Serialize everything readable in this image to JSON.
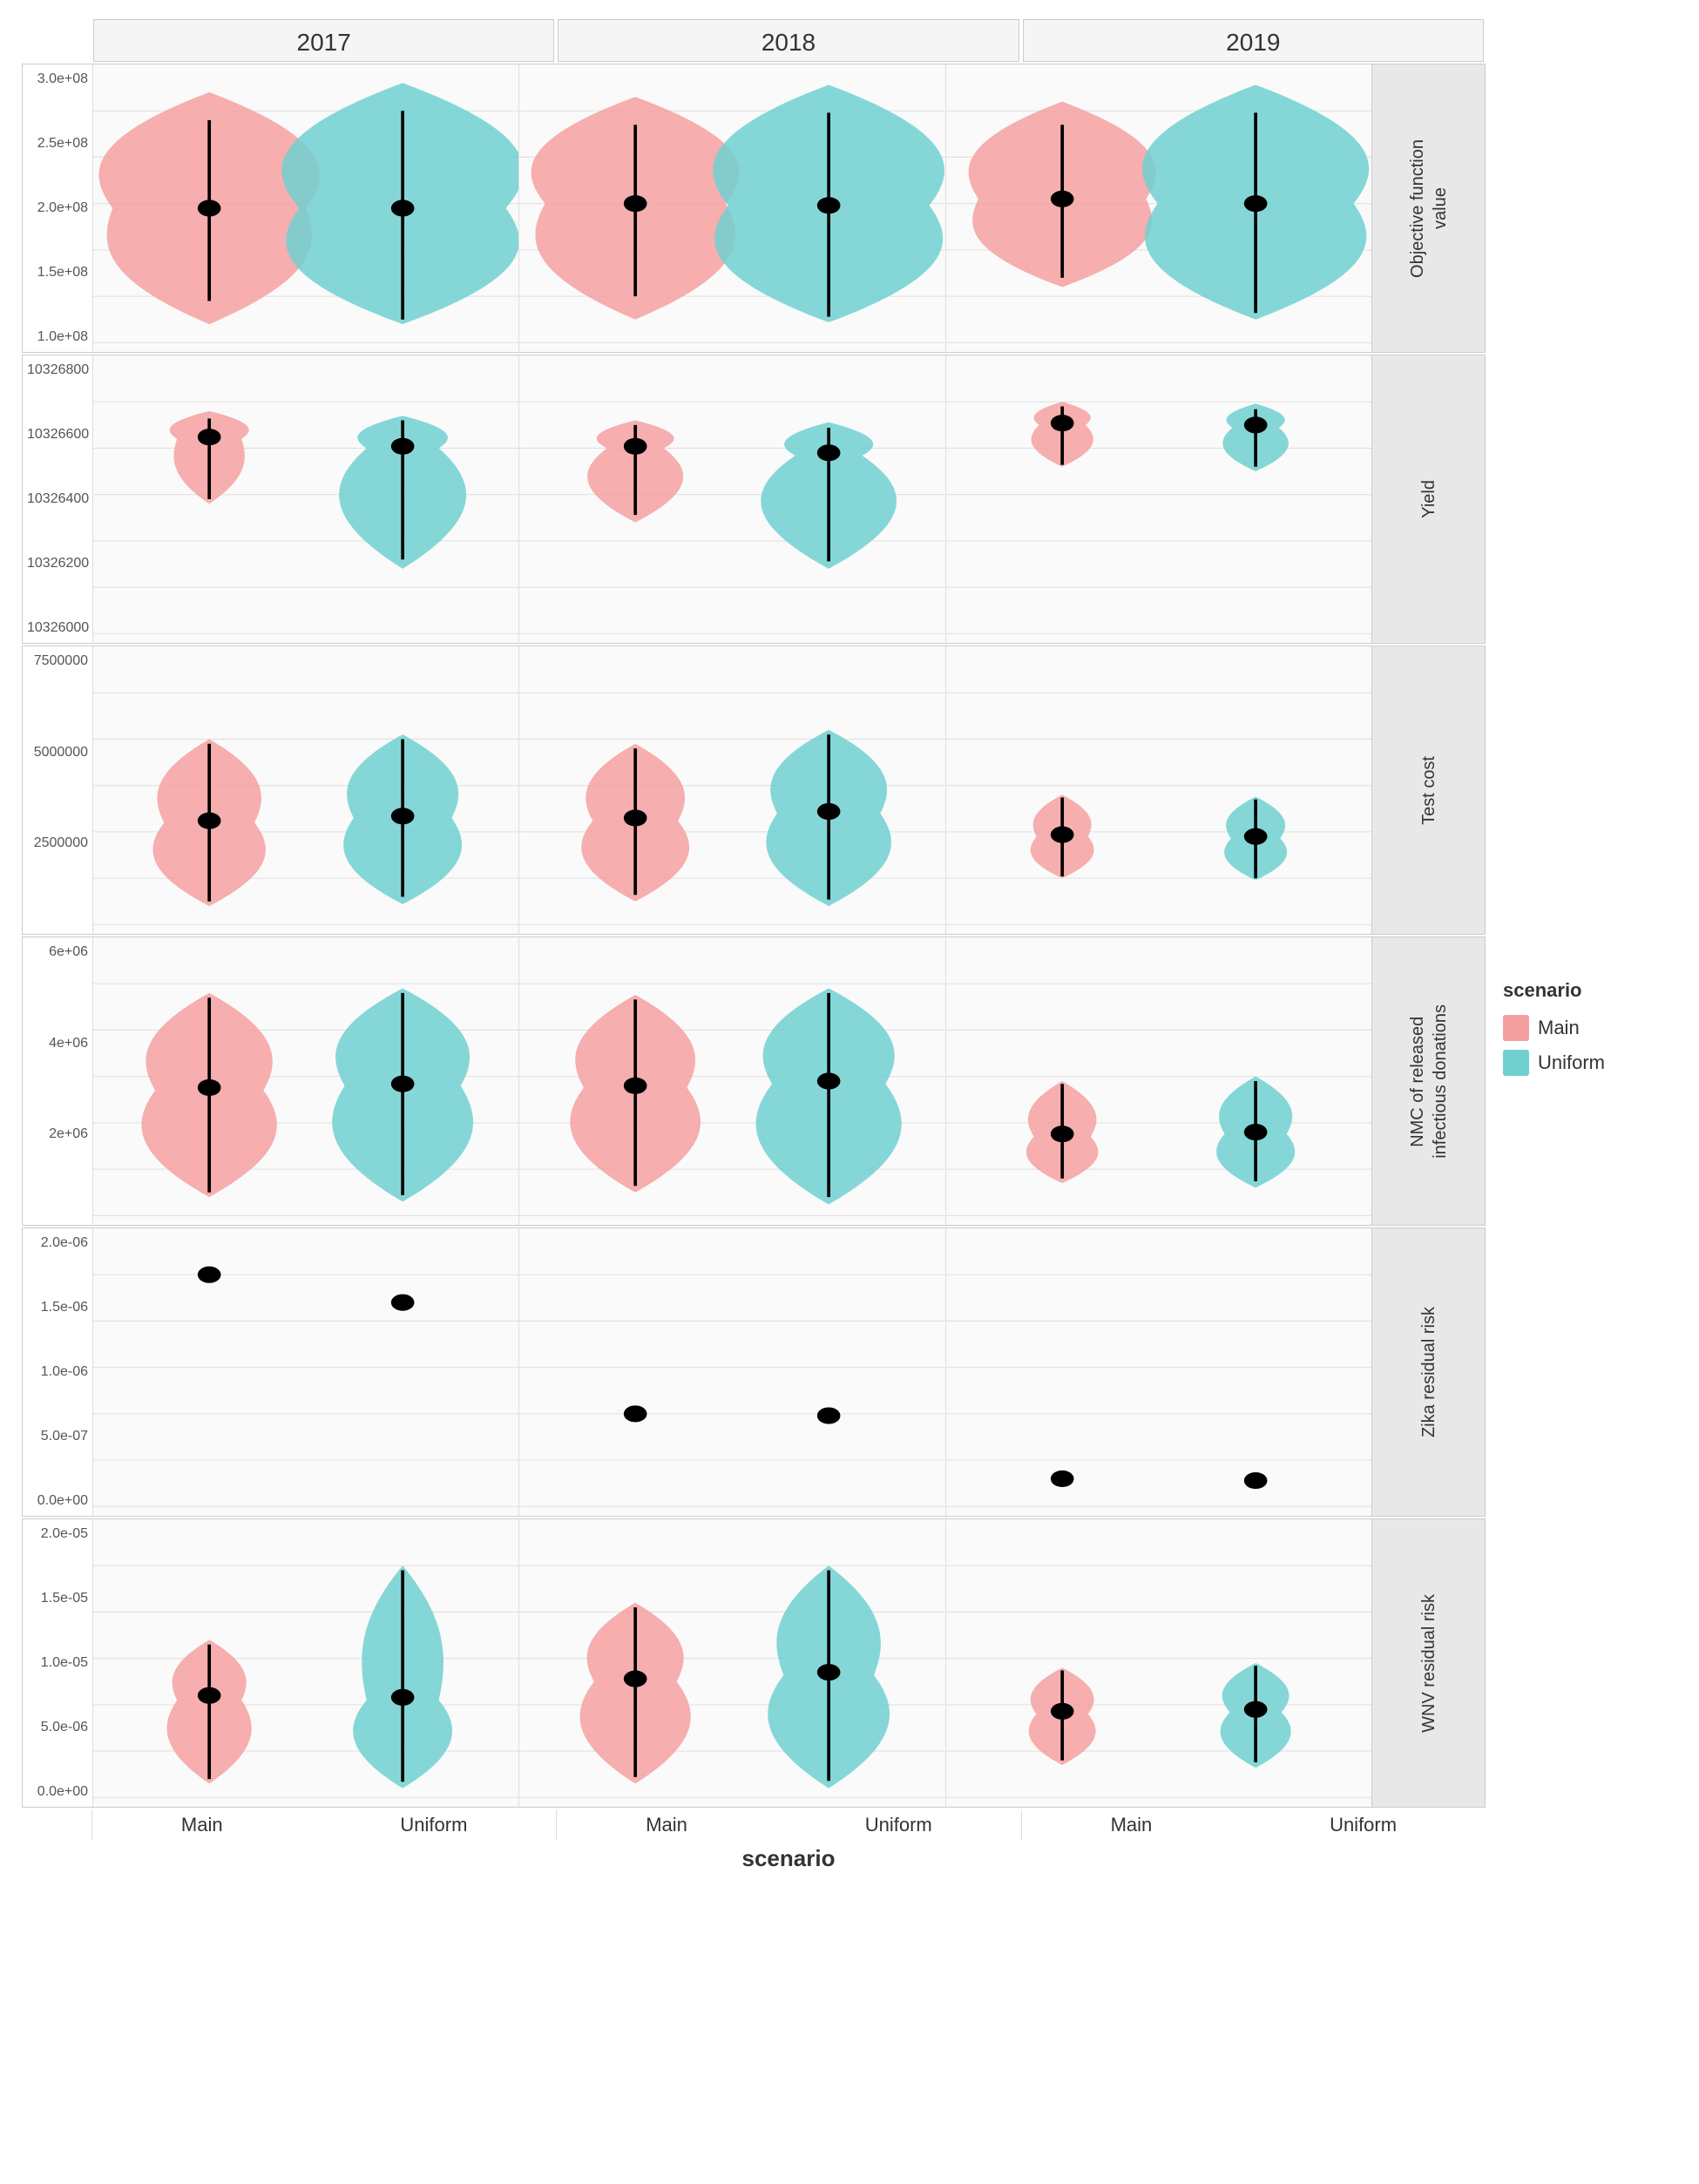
{
  "years": [
    "2017",
    "2018",
    "2019"
  ],
  "x_labels_per_cell": [
    "Main",
    "Uniform"
  ],
  "x_axis_title": "scenario",
  "legend": {
    "title": "scenario",
    "items": [
      {
        "label": "Main",
        "color": "#f4a0a0"
      },
      {
        "label": "Uniform",
        "color": "#70d0d0"
      }
    ]
  },
  "rows": [
    {
      "label": "Objective function\nvalue",
      "y_ticks": [
        "3.0e+08",
        "2.5e+08",
        "2.0e+08",
        "1.5e+08",
        "1.0e+08"
      ],
      "cells": [
        {
          "main_violin": {
            "cx": 90,
            "top": 30,
            "bottom": 280,
            "waist_y": 155,
            "waist_half": 10,
            "top_half": 95,
            "bottom_half": 85,
            "mid_half": 75
          },
          "uniform_violin": {
            "cx": 240,
            "top": 20,
            "bottom": 280,
            "waist_y": 155,
            "waist_half": 15,
            "top_half": 105,
            "bottom_half": 100,
            "mid_half": 80
          },
          "main_dot": {
            "cx": 90,
            "cy": 155
          },
          "main_whisker": {
            "cx": 90,
            "y1": 60,
            "y2": 255
          },
          "uniform_dot": {
            "cx": 240,
            "cy": 155
          },
          "uniform_whisker": {
            "cx": 240,
            "y1": 50,
            "y2": 275
          }
        },
        {
          "main_violin": {
            "cx": 90,
            "top": 35,
            "bottom": 275,
            "waist_y": 150,
            "waist_half": 8,
            "top_half": 90,
            "bottom_half": 85,
            "mid_half": 70
          },
          "uniform_violin": {
            "cx": 240,
            "top": 22,
            "bottom": 278,
            "waist_y": 152,
            "waist_half": 14,
            "top_half": 100,
            "bottom_half": 98,
            "mid_half": 78
          },
          "main_dot": {
            "cx": 90,
            "cy": 150
          },
          "main_whisker": {
            "cx": 90,
            "y1": 65,
            "y2": 250
          },
          "uniform_dot": {
            "cx": 240,
            "cy": 152
          },
          "uniform_whisker": {
            "cx": 240,
            "y1": 52,
            "y2": 272
          }
        },
        {
          "main_violin": {
            "cx": 90,
            "top": 40,
            "bottom": 240,
            "waist_y": 145,
            "waist_half": 7,
            "top_half": 80,
            "bottom_half": 75,
            "mid_half": 65
          },
          "uniform_violin": {
            "cx": 240,
            "top": 22,
            "bottom": 275,
            "waist_y": 150,
            "waist_half": 13,
            "top_half": 98,
            "bottom_half": 95,
            "mid_half": 76
          },
          "main_dot": {
            "cx": 90,
            "cy": 145
          },
          "main_whisker": {
            "cx": 90,
            "y1": 65,
            "y2": 230
          },
          "uniform_dot": {
            "cx": 240,
            "cy": 150
          },
          "uniform_whisker": {
            "cx": 240,
            "y1": 52,
            "y2": 268
          }
        }
      ]
    },
    {
      "label": "Yield",
      "y_ticks": [
        "10326800",
        "10326600",
        "10326400",
        "10326200",
        "10326000"
      ],
      "cells": [
        {
          "main_violin": {
            "cx": 90,
            "top": 60,
            "bottom": 160,
            "waist_y": 90,
            "waist_half": 4,
            "top_half": 35,
            "bottom_half": 30,
            "mid_half": 25
          },
          "uniform_violin": {
            "cx": 240,
            "top": 65,
            "bottom": 230,
            "waist_y": 100,
            "waist_half": 5,
            "top_half": 40,
            "bottom_half": 60,
            "mid_half": 28
          },
          "main_dot": {
            "cx": 90,
            "cy": 88
          },
          "main_whisker": {
            "cx": 90,
            "y1": 68,
            "y2": 155
          },
          "uniform_dot": {
            "cx": 240,
            "cy": 98
          },
          "uniform_whisker": {
            "cx": 240,
            "y1": 70,
            "y2": 220
          }
        },
        {
          "main_violin": {
            "cx": 90,
            "top": 70,
            "bottom": 180,
            "waist_y": 100,
            "waist_half": 4,
            "top_half": 35,
            "bottom_half": 45,
            "mid_half": 22
          },
          "uniform_violin": {
            "cx": 240,
            "top": 72,
            "bottom": 230,
            "waist_y": 108,
            "waist_half": 5,
            "top_half": 40,
            "bottom_half": 65,
            "mid_half": 26
          },
          "main_dot": {
            "cx": 90,
            "cy": 98
          },
          "main_whisker": {
            "cx": 90,
            "y1": 75,
            "y2": 172
          },
          "uniform_dot": {
            "cx": 240,
            "cy": 105
          },
          "uniform_whisker": {
            "cx": 240,
            "y1": 78,
            "y2": 222
          }
        },
        {
          "main_violin": {
            "cx": 90,
            "top": 50,
            "bottom": 120,
            "waist_y": 75,
            "waist_half": 3,
            "top_half": 25,
            "bottom_half": 28,
            "mid_half": 18
          },
          "uniform_violin": {
            "cx": 240,
            "top": 52,
            "bottom": 125,
            "waist_y": 78,
            "waist_half": 3,
            "top_half": 26,
            "bottom_half": 30,
            "mid_half": 18
          },
          "main_dot": {
            "cx": 90,
            "cy": 73
          },
          "main_whisker": {
            "cx": 90,
            "y1": 55,
            "y2": 118
          },
          "uniform_dot": {
            "cx": 240,
            "cy": 75
          },
          "uniform_whisker": {
            "cx": 240,
            "y1": 58,
            "y2": 120
          }
        }
      ]
    },
    {
      "label": "Test cost",
      "y_ticks": [
        "7500000",
        "5000000",
        "2500000",
        ""
      ],
      "cells": [
        {
          "main_violin": {
            "cx": 90,
            "top": 100,
            "bottom": 280,
            "waist_y": 190,
            "waist_half": 5,
            "top_half": 45,
            "bottom_half": 50,
            "mid_half": 35
          },
          "uniform_violin": {
            "cx": 240,
            "top": 95,
            "bottom": 278,
            "waist_y": 185,
            "waist_half": 6,
            "top_half": 48,
            "bottom_half": 52,
            "mid_half": 38
          },
          "main_dot": {
            "cx": 90,
            "cy": 188
          },
          "main_whisker": {
            "cx": 90,
            "y1": 105,
            "y2": 275
          },
          "uniform_dot": {
            "cx": 240,
            "cy": 183
          },
          "uniform_whisker": {
            "cx": 240,
            "y1": 100,
            "y2": 270
          }
        },
        {
          "main_violin": {
            "cx": 90,
            "top": 105,
            "bottom": 275,
            "waist_y": 188,
            "waist_half": 5,
            "top_half": 43,
            "bottom_half": 48,
            "mid_half": 33
          },
          "uniform_violin": {
            "cx": 240,
            "top": 90,
            "bottom": 280,
            "waist_y": 180,
            "waist_half": 7,
            "top_half": 50,
            "bottom_half": 55,
            "mid_half": 40
          },
          "main_dot": {
            "cx": 90,
            "cy": 185
          },
          "main_whisker": {
            "cx": 90,
            "y1": 110,
            "y2": 268
          },
          "uniform_dot": {
            "cx": 240,
            "cy": 178
          },
          "uniform_whisker": {
            "cx": 240,
            "y1": 95,
            "y2": 273
          }
        },
        {
          "main_violin": {
            "cx": 90,
            "top": 160,
            "bottom": 250,
            "waist_y": 205,
            "waist_half": 4,
            "top_half": 25,
            "bottom_half": 28,
            "mid_half": 20
          },
          "uniform_violin": {
            "cx": 240,
            "top": 162,
            "bottom": 252,
            "waist_y": 207,
            "waist_half": 4,
            "top_half": 26,
            "bottom_half": 28,
            "mid_half": 19
          },
          "main_dot": {
            "cx": 90,
            "cy": 203
          },
          "main_whisker": {
            "cx": 90,
            "y1": 163,
            "y2": 248
          },
          "uniform_dot": {
            "cx": 240,
            "cy": 205
          },
          "uniform_whisker": {
            "cx": 240,
            "y1": 165,
            "y2": 250
          }
        }
      ]
    },
    {
      "label": "NMC of released\ninfectious donations",
      "y_ticks": [
        "6e+06",
        "4e+06",
        "2e+06",
        ""
      ],
      "cells": [
        {
          "main_violin": {
            "cx": 90,
            "top": 60,
            "bottom": 280,
            "waist_y": 165,
            "waist_half": 6,
            "top_half": 55,
            "bottom_half": 60,
            "mid_half": 42
          },
          "uniform_violin": {
            "cx": 240,
            "top": 55,
            "bottom": 285,
            "waist_y": 160,
            "waist_half": 7,
            "top_half": 58,
            "bottom_half": 62,
            "mid_half": 45
          },
          "main_dot": {
            "cx": 90,
            "cy": 162
          },
          "main_whisker": {
            "cx": 90,
            "y1": 65,
            "y2": 275
          },
          "uniform_dot": {
            "cx": 240,
            "cy": 158
          },
          "uniform_whisker": {
            "cx": 240,
            "y1": 60,
            "y2": 278
          }
        },
        {
          "main_violin": {
            "cx": 90,
            "top": 62,
            "bottom": 275,
            "waist_y": 162,
            "waist_half": 6,
            "top_half": 52,
            "bottom_half": 58,
            "mid_half": 40
          },
          "uniform_violin": {
            "cx": 240,
            "top": 55,
            "bottom": 288,
            "waist_y": 158,
            "waist_half": 7,
            "top_half": 57,
            "bottom_half": 65,
            "mid_half": 44
          },
          "main_dot": {
            "cx": 90,
            "cy": 160
          },
          "main_whisker": {
            "cx": 90,
            "y1": 67,
            "y2": 268
          },
          "uniform_dot": {
            "cx": 240,
            "cy": 155
          },
          "uniform_whisker": {
            "cx": 240,
            "y1": 60,
            "y2": 280
          }
        },
        {
          "main_violin": {
            "cx": 90,
            "top": 155,
            "bottom": 265,
            "waist_y": 215,
            "waist_half": 5,
            "top_half": 30,
            "bottom_half": 32,
            "mid_half": 22
          },
          "uniform_violin": {
            "cx": 240,
            "top": 150,
            "bottom": 270,
            "waist_y": 212,
            "waist_half": 5,
            "top_half": 32,
            "bottom_half": 35,
            "mid_half": 24
          },
          "main_dot": {
            "cx": 90,
            "cy": 212
          },
          "main_whisker": {
            "cx": 90,
            "y1": 158,
            "y2": 260
          },
          "uniform_dot": {
            "cx": 240,
            "cy": 210
          },
          "uniform_whisker": {
            "cx": 240,
            "y1": 155,
            "y2": 263
          }
        }
      ]
    },
    {
      "label": "Zika residual risk",
      "y_ticks": [
        "2.0e-06",
        "1.5e-06",
        "1.0e-06",
        "5.0e-07",
        "0.0e+00"
      ],
      "cells": [
        {
          "main_violin": null,
          "uniform_violin": null,
          "main_dot": {
            "cx": 90,
            "cy": 50
          },
          "main_whisker": null,
          "uniform_dot": {
            "cx": 240,
            "cy": 80
          },
          "uniform_whisker": null
        },
        {
          "main_violin": null,
          "uniform_violin": null,
          "main_dot": {
            "cx": 90,
            "cy": 200
          },
          "main_whisker": null,
          "uniform_dot": {
            "cx": 240,
            "cy": 202
          },
          "uniform_whisker": null
        },
        {
          "main_violin": null,
          "uniform_violin": null,
          "main_dot": {
            "cx": 90,
            "cy": 270
          },
          "main_whisker": null,
          "uniform_dot": {
            "cx": 240,
            "cy": 272
          },
          "uniform_whisker": null
        }
      ]
    },
    {
      "label": "WNV residual risk",
      "y_ticks": [
        "2.0e-05",
        "1.5e-05",
        "1.0e-05",
        "5.0e-06",
        "0.0e+00"
      ],
      "cells": [
        {
          "main_violin": {
            "cx": 90,
            "top": 130,
            "bottom": 285,
            "waist_y": 195,
            "waist_half": 4,
            "top_half": 32,
            "bottom_half": 38,
            "mid_half": 25
          },
          "uniform_violin": {
            "cx": 240,
            "top": 50,
            "bottom": 290,
            "waist_y": 195,
            "waist_half": 4,
            "top_half": 35,
            "bottom_half": 45,
            "mid_half": 28
          },
          "main_dot": {
            "cx": 90,
            "cy": 190
          },
          "main_whisker": {
            "cx": 90,
            "y1": 135,
            "y2": 280
          },
          "uniform_dot": {
            "cx": 240,
            "cy": 192
          },
          "uniform_whisker": {
            "cx": 240,
            "y1": 55,
            "y2": 283
          }
        },
        {
          "main_violin": {
            "cx": 90,
            "top": 90,
            "bottom": 285,
            "waist_y": 175,
            "waist_half": 5,
            "top_half": 42,
            "bottom_half": 50,
            "mid_half": 32
          },
          "uniform_violin": {
            "cx": 240,
            "top": 50,
            "bottom": 290,
            "waist_y": 168,
            "waist_half": 5,
            "top_half": 45,
            "bottom_half": 55,
            "mid_half": 35
          },
          "main_dot": {
            "cx": 90,
            "cy": 172
          },
          "main_whisker": {
            "cx": 90,
            "y1": 95,
            "y2": 278
          },
          "uniform_dot": {
            "cx": 240,
            "cy": 165
          },
          "uniform_whisker": {
            "cx": 240,
            "y1": 55,
            "y2": 282
          }
        },
        {
          "main_violin": {
            "cx": 90,
            "top": 160,
            "bottom": 265,
            "waist_y": 210,
            "waist_half": 4,
            "top_half": 28,
            "bottom_half": 30,
            "mid_half": 20
          },
          "uniform_violin": {
            "cx": 240,
            "top": 155,
            "bottom": 268,
            "waist_y": 208,
            "waist_half": 4,
            "top_half": 30,
            "bottom_half": 32,
            "mid_half": 20
          },
          "main_dot": {
            "cx": 90,
            "cy": 207
          },
          "main_whisker": {
            "cx": 90,
            "y1": 163,
            "y2": 260
          },
          "uniform_dot": {
            "cx": 240,
            "cy": 205
          },
          "uniform_whisker": {
            "cx": 240,
            "y1": 158,
            "y2": 262
          }
        }
      ]
    }
  ]
}
